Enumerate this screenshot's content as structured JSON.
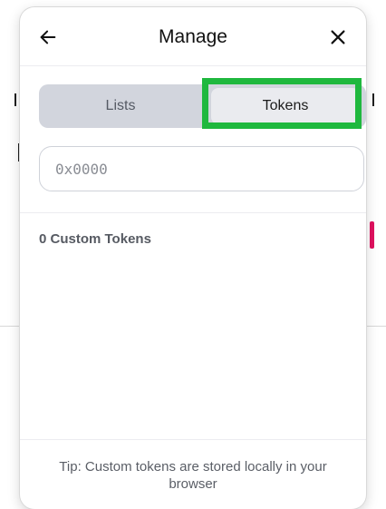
{
  "modal": {
    "title": "Manage"
  },
  "tabs": [
    {
      "label": "Lists",
      "active": false
    },
    {
      "label": "Tokens",
      "active": true
    }
  ],
  "search": {
    "placeholder": "0x0000",
    "value": ""
  },
  "custom_tokens": {
    "count_label": "0 Custom Tokens"
  },
  "footer": {
    "tip": "Tip: Custom tokens are stored locally in your browser"
  },
  "icons": {
    "back": "arrow-left-icon",
    "close": "close-icon"
  },
  "colors": {
    "highlight": "#1fb83e",
    "tab_track": "#d2d5dd",
    "tab_active": "#eaebef",
    "accent_backdrop": "#e0115f"
  }
}
